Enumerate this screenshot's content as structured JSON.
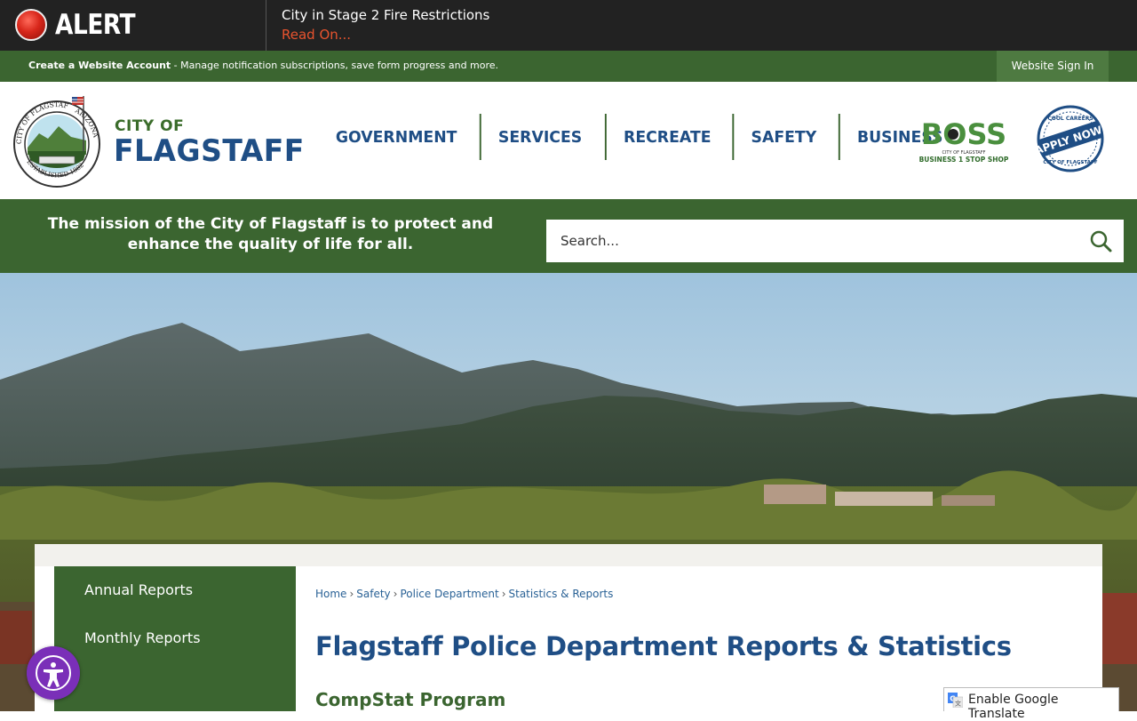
{
  "alert": {
    "label": "ALERT",
    "title": "City in Stage 2 Fire Restrictions",
    "link": "Read On..."
  },
  "account_bar": {
    "create_link": "Create a Website Account",
    "description": " - Manage notification subscriptions, save form progress and more.",
    "signin": "Website Sign In"
  },
  "logo": {
    "city_of": "CITY OF",
    "name": "FLAGSTAFF",
    "seal_top": "CITY OF FLAGSTAFF",
    "seal_right": "ARIZONA",
    "seal_bottom": "ESTABLISHED 1882"
  },
  "nav": {
    "items": [
      "GOVERNMENT",
      "SERVICES",
      "RECREATE",
      "SAFETY",
      "BUSINESS"
    ]
  },
  "badges": {
    "boss_title": "BOSS",
    "boss_city": "CITY OF FLAGSTAFF",
    "boss_sub": "BUSINESS 1 STOP SHOP",
    "apply_top": "COOL CAREERS",
    "apply_main": "APPLY NOW!",
    "apply_bottom": "CITY OF FLAGSTAFF"
  },
  "mission": {
    "text": "The mission of the City of Flagstaff is to protect and enhance the quality of life for all."
  },
  "search": {
    "placeholder": "Search..."
  },
  "sidenav": {
    "items": [
      "Annual Reports",
      "Monthly Reports"
    ]
  },
  "breadcrumb": [
    "Home",
    "Safety",
    "Police Department",
    "Statistics & Reports"
  ],
  "page": {
    "title": "Flagstaff Police Department Reports & Statistics",
    "subhead": "CompStat Program"
  },
  "translate": {
    "label": "Enable Google Translate"
  },
  "colors": {
    "alert_bg": "#222222",
    "brand_green": "#3b6530",
    "brand_blue": "#1f4e85",
    "link_orange": "#e8532e",
    "a11y_purple": "#7a2fb8"
  },
  "icons": [
    "alert-dot-icon",
    "search-icon",
    "accessibility-icon",
    "google-translate-icon",
    "city-seal-logo",
    "boss-logo",
    "apply-now-badge"
  ]
}
